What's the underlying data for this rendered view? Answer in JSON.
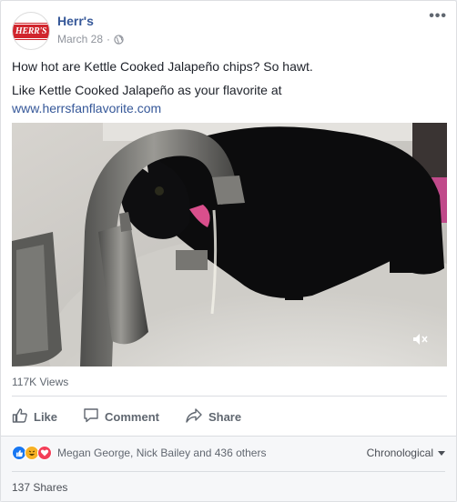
{
  "post": {
    "page_name": "Herr's",
    "date": "March 28",
    "separator": "·",
    "logo_text": "HERR'S",
    "menu_label": "•••",
    "text_line1": "How hot are Kettle Cooked Jalapeño chips? So hawt.",
    "text_line2": "Like Kettle Cooked Jalapeño as your flavorite at",
    "link": "www.herrsfanflavorite.com"
  },
  "video": {
    "views": "117K Views",
    "muted_icon": "speaker-muted-icon"
  },
  "actions": {
    "like": "Like",
    "comment": "Comment",
    "share": "Share"
  },
  "footer": {
    "reactions_text": "Megan George, Nick Bailey and 436 others",
    "sort_label": "Chronological",
    "shares": "137 Shares"
  },
  "colors": {
    "link": "#365899",
    "like_blue": "#1877f2",
    "haha_yellow": "#f7b125",
    "love_red": "#f33e58"
  }
}
